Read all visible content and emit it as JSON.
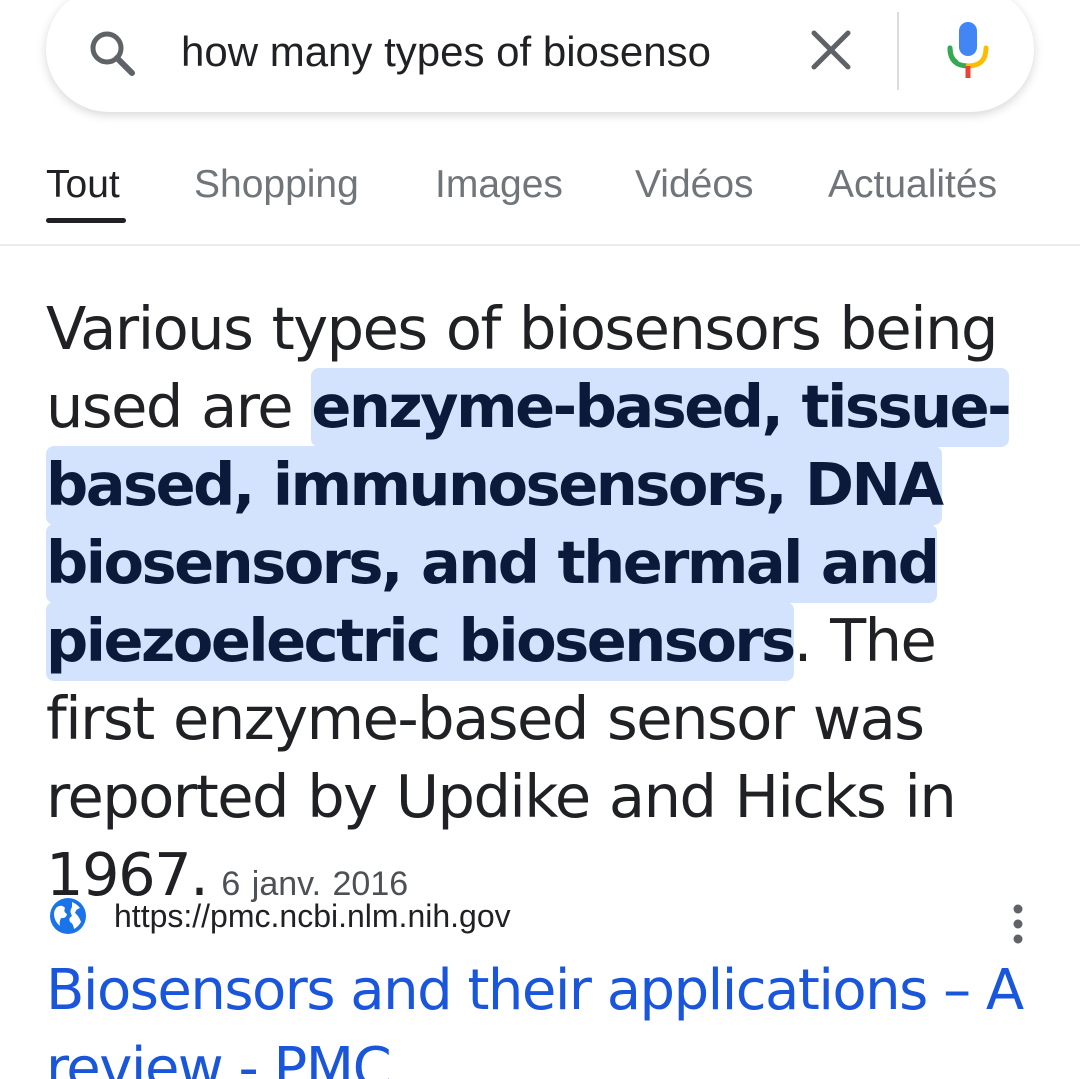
{
  "search": {
    "query": "how many types of biosenso"
  },
  "tabs": [
    {
      "label": "Tout",
      "active": true
    },
    {
      "label": "Shopping",
      "active": false
    },
    {
      "label": "Images",
      "active": false
    },
    {
      "label": "Vidéos",
      "active": false
    },
    {
      "label": "Actualités",
      "active": false
    }
  ],
  "answer": {
    "prefix": "Various types of biosensors being used are ",
    "highlight": "enzyme-based, tissue-based, immunosensors, DNA biosensors, and thermal and piezoelectric biosensors",
    "suffix": ". The first enzyme-based sensor was reported by Updike and Hicks in 1967.",
    "date": "6 janv. 2016"
  },
  "result": {
    "url": "https://pmc.ncbi.nlm.nih.gov",
    "title": "Biosensors and their applications – A review - PMC"
  },
  "icons": {
    "search": "search-icon",
    "clear": "close-icon",
    "mic": "mic-icon",
    "globe": "globe-icon",
    "more": "more-vert-icon"
  },
  "colors": {
    "highlight_bg": "#d3e3fd",
    "link": "#1a56db",
    "text": "#202124",
    "muted": "#70757a"
  }
}
